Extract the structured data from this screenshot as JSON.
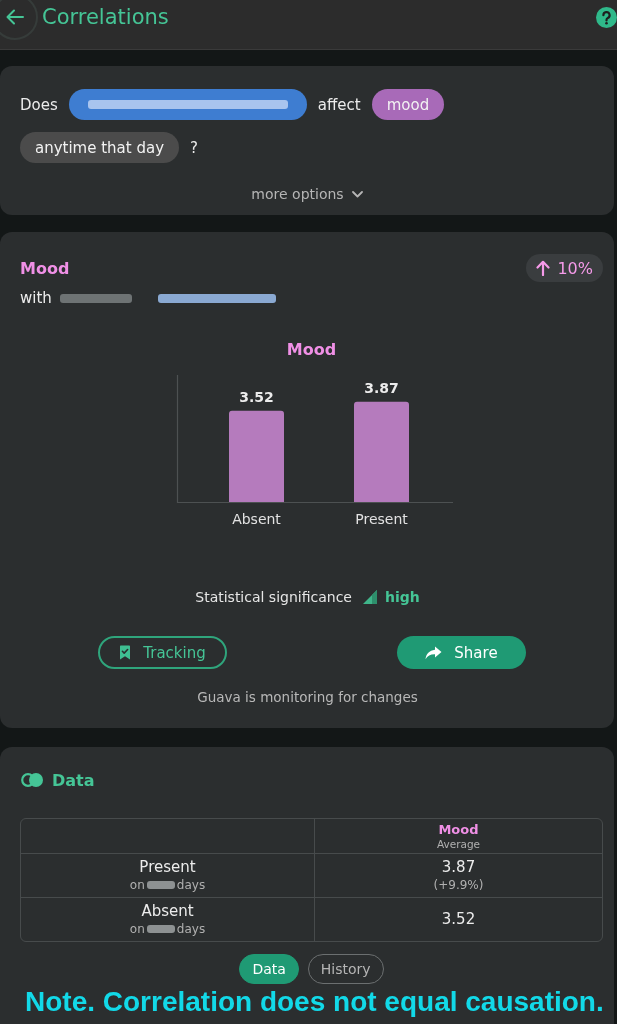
{
  "header": {
    "title": "Correlations"
  },
  "question": {
    "parts": [
      {
        "kind": "text",
        "text": "Does"
      },
      {
        "kind": "chip",
        "color": "#3e7dd1",
        "redacted": true
      },
      {
        "kind": "text",
        "text": "affect"
      },
      {
        "kind": "chip",
        "color": "#a86ab8",
        "text": "mood"
      },
      {
        "kind": "chip",
        "color": "#4b4b4b",
        "text": "anytime that day"
      },
      {
        "kind": "text",
        "text": "?"
      }
    ],
    "more_options": "more options"
  },
  "result": {
    "title": "Mood",
    "change": {
      "increase": true,
      "text": "10%"
    },
    "subtitle": [
      {
        "kind": "text",
        "text": "with"
      },
      {
        "kind": "redacted",
        "link": false
      },
      {
        "kind": "redacted",
        "link": true
      }
    ],
    "chart_data": {
      "type": "bar",
      "title": "Mood",
      "categories": [
        "Absent",
        "Present"
      ],
      "values": [
        3.52,
        3.87
      ],
      "ylim": [
        0,
        4.9
      ],
      "data_labels": true
    },
    "significance": {
      "label": "Statistical significance",
      "value": "high"
    },
    "actions": [
      {
        "kind": "toggle",
        "label": "Tracking"
      },
      {
        "kind": "action",
        "label": "Share"
      }
    ],
    "monitoring_note": "Guava is monitoring for changes"
  },
  "data": {
    "title": "Data",
    "table": {
      "column": {
        "title": "Mood",
        "subtitle": "Average"
      },
      "rows": [
        {
          "label": "Present",
          "sublabel": {
            "prefix": "on",
            "suffix": "days",
            "redacted": true
          },
          "value": "3.87",
          "change": "(+9.9%)"
        },
        {
          "label": "Absent",
          "sublabel": {
            "prefix": "on",
            "suffix": "days",
            "redacted": true
          },
          "value": "3.52"
        }
      ]
    },
    "tabs": [
      {
        "label": "Data",
        "selected": true
      },
      {
        "label": "History",
        "selected": false
      }
    ]
  },
  "note": "Note. Correlation does not equal causation."
}
